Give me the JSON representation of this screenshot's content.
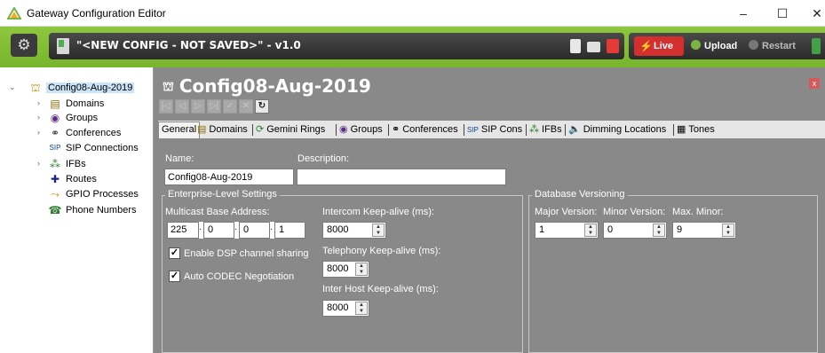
{
  "window": {
    "title": "Gateway Configuration Editor",
    "minimize": "–",
    "maximize": "☐",
    "close": "✕"
  },
  "toolbar": {
    "config_title": "\"<NEW CONFIG - NOT SAVED>\" - v1.0",
    "live_label": "Live",
    "upload_label": "Upload",
    "restart_label": "Restart"
  },
  "tree": {
    "root": "Config08-Aug-2019",
    "items": [
      {
        "label": "Domains",
        "icon": "domains-icon"
      },
      {
        "label": "Groups",
        "icon": "groups-icon"
      },
      {
        "label": "Conferences",
        "icon": "conferences-icon"
      },
      {
        "label": "SIP Connections",
        "icon": "sip-icon"
      },
      {
        "label": "IFBs",
        "icon": "ifbs-icon"
      },
      {
        "label": "Routes",
        "icon": "routes-icon"
      },
      {
        "label": "GPIO Processes",
        "icon": "gpio-icon"
      },
      {
        "label": "Phone Numbers",
        "icon": "phone-icon"
      }
    ]
  },
  "main": {
    "title": "Config08-Aug-2019",
    "close": "x",
    "nav": [
      "|◁",
      "◁",
      "▷",
      "▷|",
      "✓",
      "✕",
      "↻"
    ],
    "tabs": [
      "General",
      "Domains",
      "Gemini Rings",
      "Groups",
      "Conferences",
      "SIP Cons",
      "IFBs",
      "Dimming Locations",
      "Tones"
    ],
    "name_label": "Name:",
    "name_value": "Config08-Aug-2019",
    "description_label": "Description:",
    "description_value": "",
    "enterprise": {
      "title": "Enterprise-Level Settings",
      "multicast_label": "Multicast Base Address:",
      "multicast": [
        "225",
        "0",
        "0",
        "1"
      ],
      "dsp_label": "Enable DSP channel sharing",
      "dsp_checked": "✓",
      "codec_label": "Auto CODEC Negotiation",
      "codec_checked": "✓",
      "intercom_label": "Intercom Keep-alive (ms):",
      "intercom_value": "8000",
      "telephony_label": "Telephony Keep-alive (ms):",
      "telephony_value": "8000",
      "interhost_label": "Inter Host Keep-alive (ms):",
      "interhost_value": "8000"
    },
    "versioning": {
      "title": "Database Versioning",
      "major_label": "Major Version:",
      "major_value": "1",
      "minor_label": "Minor Version:",
      "minor_value": "0",
      "maxminor_label": "Max. Minor:",
      "maxminor_value": "9"
    }
  }
}
